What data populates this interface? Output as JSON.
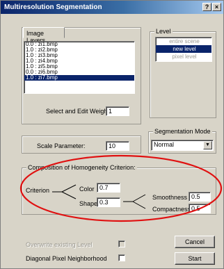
{
  "window": {
    "title": "Multiresolution Segmentation",
    "help_button": "?",
    "close_button": "×"
  },
  "image_layers": {
    "tab_label": "Image Layers",
    "items": [
      {
        "label": "0.0 : zi1.bmp",
        "selected": false
      },
      {
        "label": "1.0 : zi2.bmp",
        "selected": false
      },
      {
        "label": "1.0 : zi3.bmp",
        "selected": false
      },
      {
        "label": "1.0 : zi4.bmp",
        "selected": false
      },
      {
        "label": "1.0 : zi5.bmp",
        "selected": false
      },
      {
        "label": "0.0 : zi6.bmp",
        "selected": false
      },
      {
        "label": "1.0 : zi7.bmp",
        "selected": true
      }
    ],
    "weights_label": "Select and Edit Weights:",
    "weights_value": "1"
  },
  "level": {
    "legend": "Level",
    "items": [
      {
        "label": "entire scene",
        "selected": false,
        "greyed": true
      },
      {
        "label": "new level",
        "selected": true,
        "greyed": false
      },
      {
        "label": "pixel level",
        "selected": false,
        "greyed": true
      }
    ]
  },
  "scale": {
    "label": "Scale Parameter:",
    "value": "10"
  },
  "segmentation_mode": {
    "legend": "Segmentation Mode",
    "value": "Normal"
  },
  "homogeneity": {
    "legend": "Composition of Homogeneity Criterion:",
    "criterion_label": "Criterion",
    "color_label": "Color",
    "color_value": "0.7",
    "shape_label": "Shape",
    "shape_value": "0.3",
    "smoothness_label": "Smoothness",
    "smoothness_value": "0.5",
    "compactness_label": "Compactness",
    "compactness_value": "0.5"
  },
  "options": {
    "overwrite_label": "Overwrite existing Level",
    "overwrite_checked": false,
    "overwrite_enabled": false,
    "diagonal_label": "Diagonal Pixel Neighborhood",
    "diagonal_checked": false
  },
  "buttons": {
    "cancel": "Cancel",
    "start": "Start"
  },
  "annotation": {
    "ellipse_color": "#e01010"
  }
}
